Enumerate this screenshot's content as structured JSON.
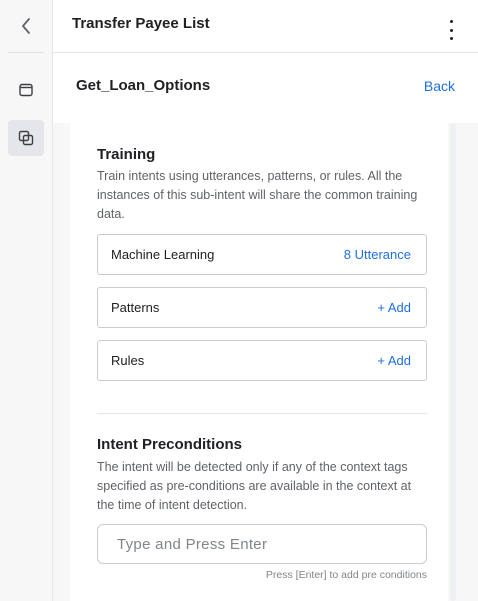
{
  "header": {
    "title": "Transfer Payee List",
    "menu_icon": "kebab-icon"
  },
  "rail": {
    "back_icon": "chevron-left-icon",
    "items": [
      {
        "icon": "window-icon",
        "active": false
      },
      {
        "icon": "copy-icon",
        "active": true
      }
    ]
  },
  "subheader": {
    "title": "Get_Loan_Options",
    "back_label": "Back"
  },
  "training": {
    "title": "Training",
    "description": "Train intents using utterances, patterns, or rules. All the instances of this sub-intent will share the common training data.",
    "rows": [
      {
        "label": "Machine Learning",
        "action": "8 Utterance"
      },
      {
        "label": "Patterns",
        "action": "+ Add"
      },
      {
        "label": "Rules",
        "action": "+ Add"
      }
    ]
  },
  "preconditions": {
    "title": "Intent Preconditions",
    "description": "The intent will be detected only if any of the context tags specified as pre-conditions are available in the context at the time of intent detection.",
    "input_value": "",
    "input_placeholder": "Type and Press Enter",
    "hint": "Press [Enter] to add pre conditions"
  },
  "colors": {
    "accent": "#1f6fde",
    "text": "#202124",
    "muted": "#5f6368",
    "panel_bg": "#f7f7f8",
    "border": "#c9ccd1"
  }
}
